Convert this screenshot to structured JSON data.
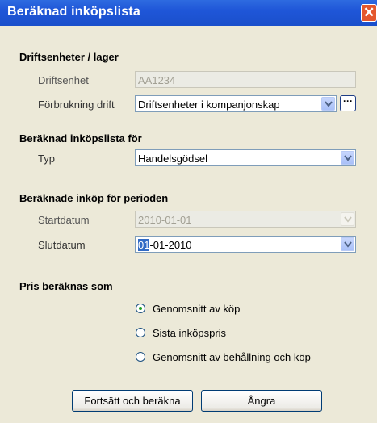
{
  "window": {
    "title": "Beräknad inköpslista"
  },
  "sections": {
    "units": "Driftsenheter / lager",
    "for": "Beräknad inköpslista för",
    "period": "Beräknade inköp för perioden",
    "price": "Pris beräknas som"
  },
  "fields": {
    "unit_label": "Driftsenhet",
    "unit_value": "AA1234",
    "consumption_label": "Förbrukning drift",
    "consumption_value": "Driftsenheter i kompanjonskap",
    "type_label": "Typ",
    "type_value": "Handelsgödsel",
    "start_label": "Startdatum",
    "start_value": "2010-01-01",
    "end_label": "Slutdatum",
    "end_value_selected": "01",
    "end_value_rest": "-01-2010"
  },
  "radios": [
    {
      "label": "Genomsnitt av köp",
      "checked": true
    },
    {
      "label": "Sista inköpspris",
      "checked": false
    },
    {
      "label": "Genomsnitt av behållning och köp",
      "checked": false
    }
  ],
  "buttons": {
    "continue": "Fortsätt och beräkna",
    "cancel": "Ångra"
  },
  "colors": {
    "titlebar": "#1F56D8",
    "dialog_bg": "#ECE9D8",
    "close": "#E4572D",
    "selection": "#316AC5"
  },
  "icons": {
    "close": "close-icon",
    "dropdown": "chevron-down-icon",
    "browse": "ellipsis-icon"
  }
}
